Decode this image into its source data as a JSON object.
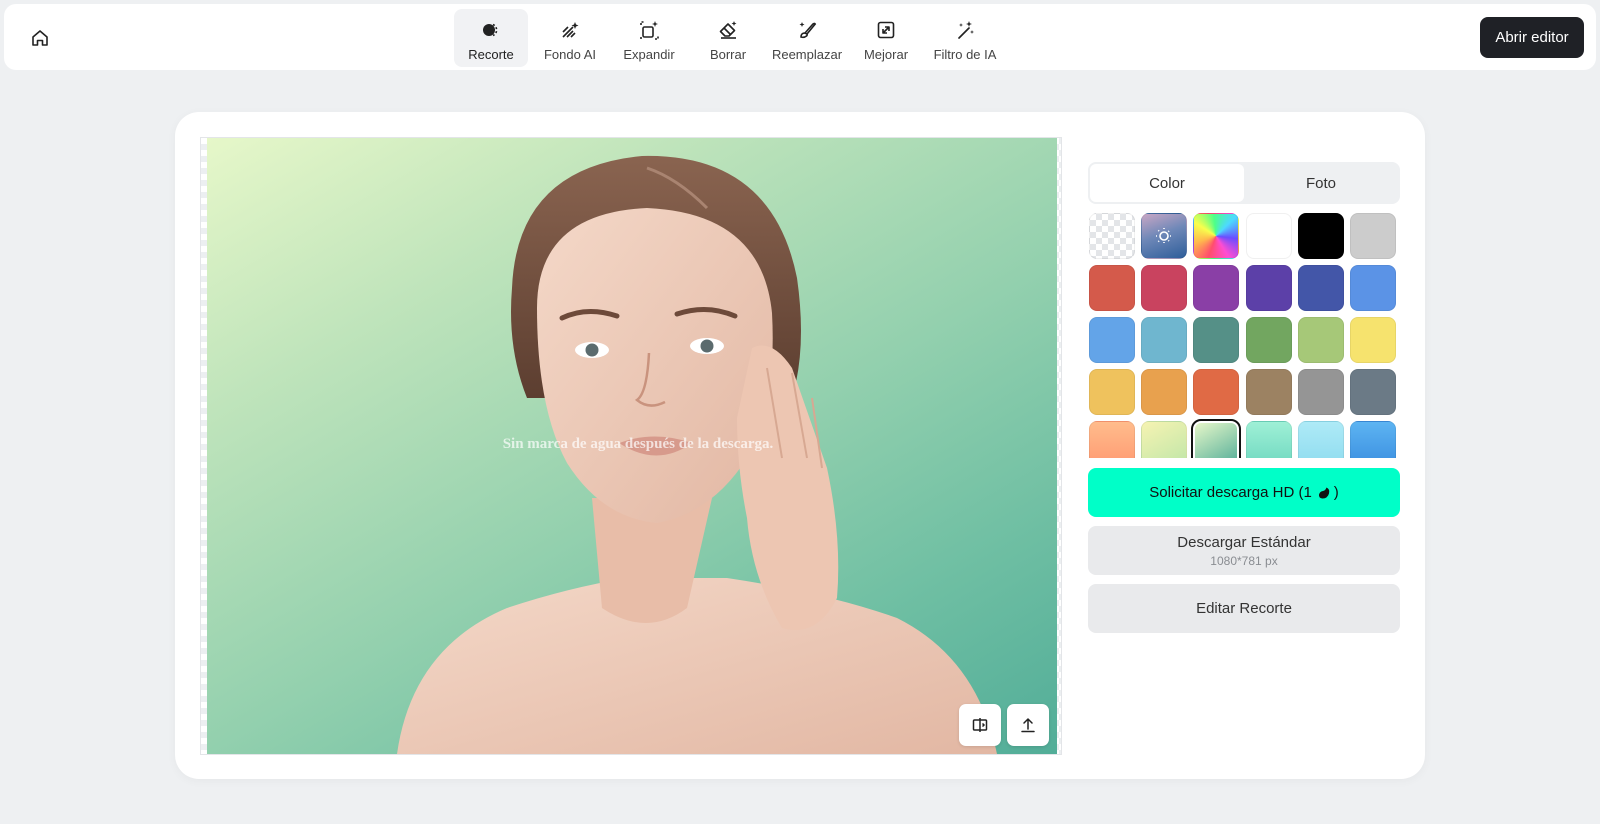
{
  "toolbar": {
    "tools": [
      {
        "label": "Recorte",
        "icon": "cutout-icon"
      },
      {
        "label": "Fondo AI",
        "icon": "ai-background-icon"
      },
      {
        "label": "Expandir",
        "icon": "expand-icon"
      },
      {
        "label": "Borrar",
        "icon": "eraser-icon"
      },
      {
        "label": "Reemplazar",
        "icon": "replace-brush-icon"
      },
      {
        "label": "Mejorar",
        "icon": "enhance-icon"
      },
      {
        "label": "Filtro de IA",
        "icon": "magic-wand-icon"
      }
    ],
    "active_tool": "Recorte",
    "open_editor_label": "Abrir editor"
  },
  "canvas": {
    "watermark": "Sin marca de agua después de la descarga."
  },
  "panel": {
    "tabs": [
      {
        "label": "Color",
        "active": true
      },
      {
        "label": "Foto",
        "active": false
      }
    ],
    "swatches": [
      "transparent",
      "picker",
      "rainbow",
      "#ffffff",
      "#000000",
      "#cccccc",
      "#d45a4b",
      "#c9435f",
      "#8a3fa6",
      "#5c40a8",
      "#4356a8",
      "#5b93e6",
      "#63a4e8",
      "#6fb6cf",
      "#559087",
      "#72a660",
      "#a6c878",
      "#f6e36e",
      "#efc25d",
      "#e8a14e",
      "#e06a45",
      "#9c8262",
      "#959595",
      "#6b7a86",
      "linear-gradient(180deg,#ffbc8c,#ff9a72)",
      "linear-gradient(150deg,#f6f3b2,#bfe6a8)",
      "linear-gradient(150deg,#e6f7c9,#52ad98)",
      "linear-gradient(180deg,#9ff0d6,#6fd8c0)",
      "linear-gradient(180deg,#aeeaf7,#8fdcef)",
      "linear-gradient(180deg,#5db4f2,#3b8fe0)"
    ],
    "selected_swatch_index": 26,
    "hd_download_label": "Solicitar descarga HD (1",
    "hd_download_suffix": ")",
    "standard_download_label": "Descargar Estándar",
    "standard_download_size": "1080*781 px",
    "edit_cutout_label": "Editar Recorte"
  }
}
